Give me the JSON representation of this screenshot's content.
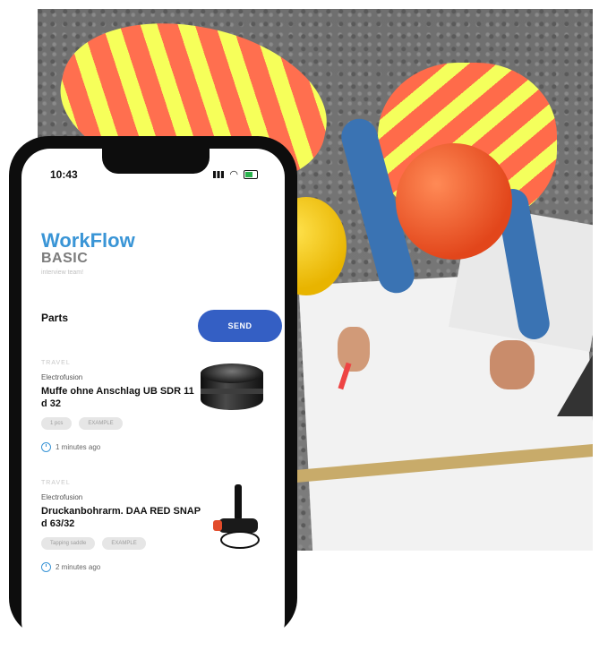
{
  "status_bar": {
    "time": "10:43"
  },
  "app": {
    "title": "WorkFlow",
    "subtitle": "BASIC",
    "tagline": "interview team!"
  },
  "parts": {
    "label": "Parts",
    "send_label": "SEND",
    "items": [
      {
        "category_top": "TRAVEL",
        "category": "Electrofusion",
        "name": "Muffe ohne Anschlag UB SDR 11 d 32",
        "tags": [
          "1 pcs",
          "EXAMPLE"
        ],
        "time": "1 minutes ago"
      },
      {
        "category_top": "TRAVEL",
        "category": "Electrofusion",
        "name": "Druckanbohrarm. DAA RED SNAP d 63/32",
        "tags": [
          "Tapping saddle",
          "EXAMPLE"
        ],
        "time": "2 minutes ago"
      }
    ]
  },
  "colors": {
    "accent": "#3a95d6",
    "button": "#345fc4"
  }
}
